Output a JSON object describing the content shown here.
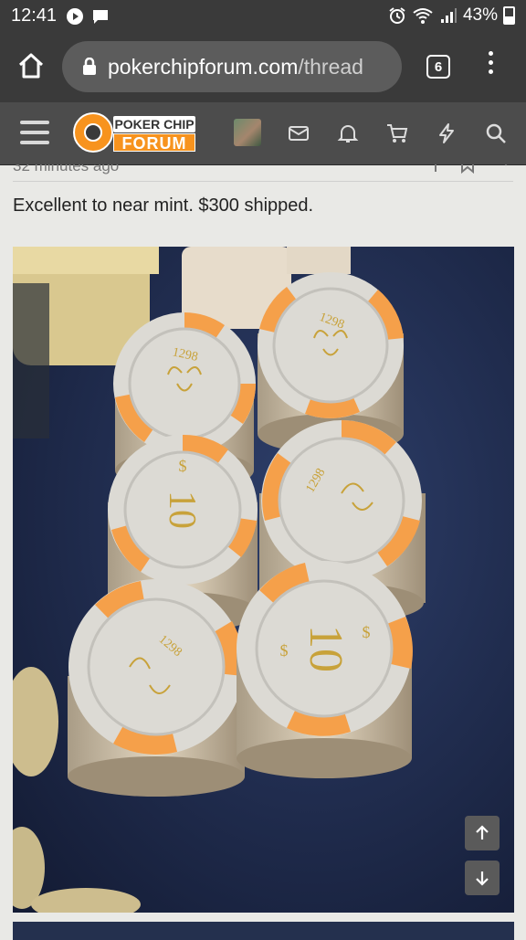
{
  "status_bar": {
    "time": "12:41",
    "battery": "43%"
  },
  "browser": {
    "url_host": "pokerchipforum.com",
    "url_path": "/thread",
    "tab_count": "6"
  },
  "forum_header": {
    "logo_line1": "POKER CHIP",
    "logo_line2": "FORUM"
  },
  "post": {
    "meta_partial": "32 minutes ago",
    "text": "Excellent to near mint. $300 shipped."
  },
  "photo": {
    "chip_denomination": "10",
    "chip_number": "1298",
    "dollar": "$"
  },
  "icons": {
    "status": [
      "play-icon",
      "message-icon",
      "alarm-icon",
      "wifi-icon",
      "signal-icon",
      "battery-icon"
    ],
    "browser": [
      "home-icon",
      "lock-icon",
      "tabs-icon",
      "overflow-menu-icon"
    ],
    "forum": [
      "hamburger-icon",
      "avatar",
      "inbox-icon",
      "bell-icon",
      "cart-icon",
      "bolt-icon",
      "search-icon"
    ],
    "scroll": [
      "arrow-up-icon",
      "arrow-down-icon"
    ]
  },
  "colors": {
    "bar_dark": "#3a3a3a",
    "forum_bar": "#4c4c4c",
    "brand_orange": "#f7931e",
    "page_bg": "#e9e9e6"
  }
}
